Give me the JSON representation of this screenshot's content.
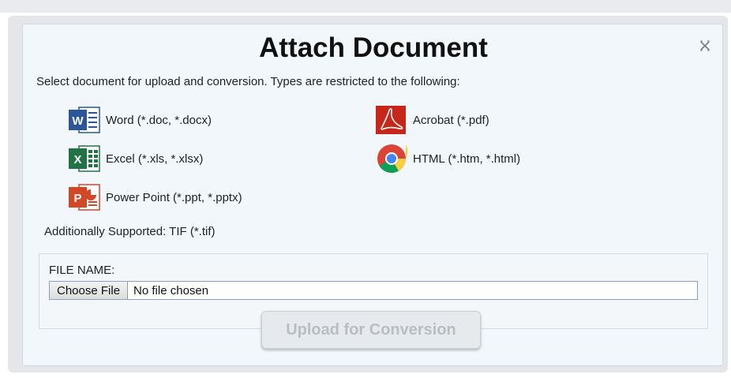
{
  "dialog": {
    "title": "Attach Document",
    "intro": "Select document for upload and conversion. Types are restricted to the following:",
    "close_icon": "close-icon"
  },
  "file_types": [
    {
      "label": "Word (*.doc, *.docx)",
      "icon": "word-icon",
      "color": "#2b579a"
    },
    {
      "label": "Acrobat (*.pdf)",
      "icon": "acrobat-icon",
      "color": "#c8261a"
    },
    {
      "label": "Excel (*.xls, *.xlsx)",
      "icon": "excel-icon",
      "color": "#217346"
    },
    {
      "label": "HTML (*.htm, *.html)",
      "icon": "chrome-icon",
      "color": "#4285f4"
    },
    {
      "label": "Power Point (*.ppt, *.pptx)",
      "icon": "powerpoint-icon",
      "color": "#d24726"
    }
  ],
  "additional": "Additionally Supported: TIF (*.tif)",
  "file": {
    "label": "FILE NAME:",
    "button_label": "Choose File",
    "status": "No file chosen"
  },
  "upload_button": {
    "label": "Upload for Conversion",
    "state": "disabled"
  }
}
